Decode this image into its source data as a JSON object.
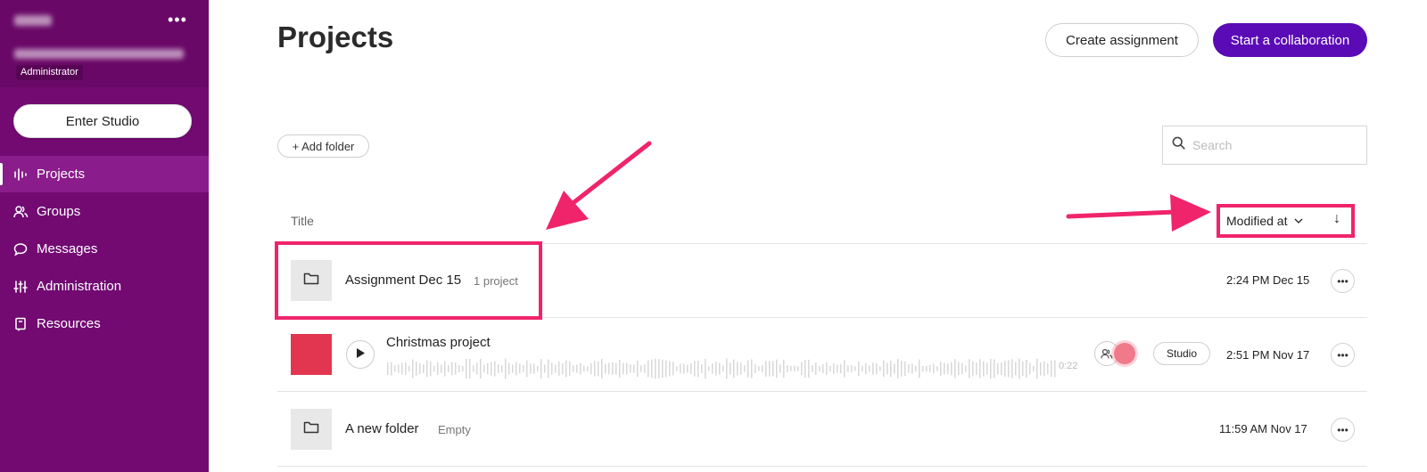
{
  "sidebar": {
    "role": "Administrator",
    "more_label": "•••",
    "enter_studio": "Enter Studio",
    "items": [
      {
        "label": "Projects",
        "icon": "waveform-icon",
        "active": true
      },
      {
        "label": "Groups",
        "icon": "groups-icon"
      },
      {
        "label": "Messages",
        "icon": "message-icon"
      },
      {
        "label": "Administration",
        "icon": "sliders-icon"
      },
      {
        "label": "Resources",
        "icon": "book-icon"
      }
    ]
  },
  "header": {
    "title": "Projects",
    "create_assignment": "Create assignment",
    "start_collaboration": "Start a collaboration"
  },
  "toolbar": {
    "add_folder": "+ Add folder",
    "search_placeholder": "Search"
  },
  "table": {
    "title_header": "Title",
    "sort_label": "Modified at",
    "sort_direction": "↓",
    "rows": [
      {
        "title": "Assignment Dec 15",
        "sub": "1 project",
        "time": "2:24 PM Dec 15",
        "type": "folder"
      },
      {
        "title": "Christmas project",
        "duration": "0:22",
        "badge": "Studio",
        "time": "2:51 PM Nov 17",
        "type": "project"
      },
      {
        "title": "A new folder",
        "sub": "Empty",
        "time": "11:59 AM Nov 17",
        "type": "folder"
      }
    ]
  },
  "colors": {
    "sidebar": "#720a72",
    "primary": "#5b0bb5",
    "annotation": "#f0246b",
    "project_thumb": "#e23650"
  }
}
